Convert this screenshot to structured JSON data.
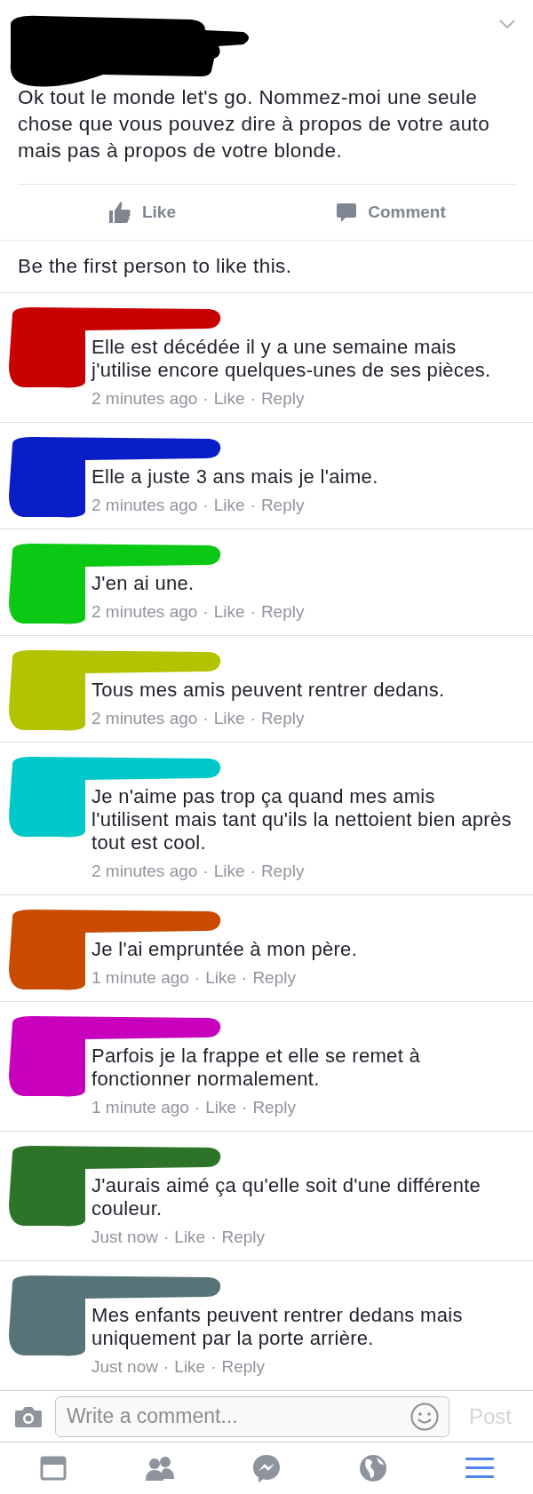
{
  "post": {
    "color": "#000000",
    "text": "Ok tout le monde let's go. Nommez-moi une seule chose que vous pouvez dire à propos de votre auto mais pas à propos de votre blonde.",
    "actions": [
      {
        "kind": "like",
        "label": "Like"
      },
      {
        "kind": "comment",
        "label": "Comment"
      }
    ],
    "likes_summary": "Be the first person to like this."
  },
  "comments": [
    {
      "color": "#c80000",
      "text": "Elle est décédée il y a une semaine mais j'utilise encore quelques-unes de ses pièces.",
      "meta": [
        "2 minutes ago",
        "·",
        "Like",
        "·",
        "Reply"
      ]
    },
    {
      "color": "#0a1ec8",
      "text": "Elle a juste 3 ans mais je l'aime.",
      "meta": [
        "2 minutes ago",
        "·",
        "Like",
        "·",
        "Reply"
      ]
    },
    {
      "color": "#0ac814",
      "text": "J'en ai une.",
      "meta": [
        "2 minutes ago",
        "·",
        "Like",
        "·",
        "Reply"
      ]
    },
    {
      "color": "#b4c300",
      "text": "Tous mes amis peuvent rentrer dedans.",
      "meta": [
        "2 minutes ago",
        "·",
        "Like",
        "·",
        "Reply"
      ]
    },
    {
      "color": "#00c8c8",
      "text": "Je n'aime pas trop ça quand mes amis l'utilisent mais tant qu'ils la nettoient bien après tout est cool.",
      "meta": [
        "2 minutes ago",
        "·",
        "Like",
        "·",
        "Reply"
      ]
    },
    {
      "color": "#c84b00",
      "text": "Je l'ai empruntée à mon père.",
      "meta": [
        "1 minute ago",
        "·",
        "Like",
        "·",
        "Reply"
      ]
    },
    {
      "color": "#c800be",
      "text": "Parfois je la frappe et elle se remet à fonctionner normalement.",
      "meta": [
        "1 minute ago",
        "·",
        "Like",
        "·",
        "Reply"
      ]
    },
    {
      "color": "#2d7328",
      "text": "J'aurais aimé ça qu'elle soit d'une différente couleur.",
      "meta": [
        "Just now",
        "·",
        "Like",
        "·",
        "Reply"
      ]
    },
    {
      "color": "#557378",
      "text": "Mes enfants peuvent rentrer dedans mais uniquement par la porte arrière.",
      "meta": [
        "Just now",
        "·",
        "Like",
        "·",
        "Reply"
      ]
    }
  ],
  "composer": {
    "placeholder": "Write a comment...",
    "post_button": "Post",
    "post_disabled": true
  },
  "nav": [
    {
      "kind": "feed",
      "selected": false
    },
    {
      "kind": "friends",
      "selected": false
    },
    {
      "kind": "messenger",
      "selected": false
    },
    {
      "kind": "globe",
      "selected": false
    },
    {
      "kind": "menu",
      "selected": true
    }
  ]
}
